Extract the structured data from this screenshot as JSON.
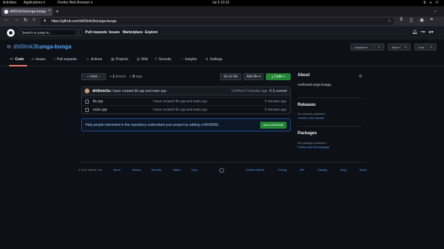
{
  "desktop": {
    "activities": "Activities",
    "applications": "Applications ▾",
    "app_name": "Firefox Web Browser ▾",
    "clock": "Jul 6  10:10",
    "tray_icons": [
      "network-icon",
      "volume-icon",
      "power-icon"
    ]
  },
  "browser": {
    "tab_title": "dh00mk3tu/unga-bunga",
    "new_tab": "+",
    "url": "https://github.com/dh00mk3tu/unga-bunga"
  },
  "github_header": {
    "search_placeholder": "Search or jump to...",
    "search_key": "/",
    "nav": [
      "Pull requests",
      "Issues",
      "Marketplace",
      "Explore"
    ]
  },
  "repo": {
    "owner": "dh00mk3tu",
    "separator": "/",
    "name": "unga-bunga",
    "unwatch": "Unwatch ▾",
    "unwatch_count": "1",
    "star": "Star ▾",
    "star_count": "0",
    "fork": "Fork",
    "fork_count": "0"
  },
  "tabs": [
    "Code",
    "Issues",
    "Pull requests",
    "Actions",
    "Projects",
    "Wiki",
    "Security",
    "Insights",
    "Settings"
  ],
  "toolbar": {
    "branch": "main ▾",
    "branches_count": "1",
    "branches_label": "branch",
    "tags_count": "0",
    "tags_label": "tags",
    "go_to_file": "Go to file",
    "add_file": "Add file ▾",
    "code": "Code ▾"
  },
  "latest_commit": {
    "author": "dh00mk3tu",
    "message": "i have created lib.cpp and main.cpp",
    "sha": "7c244e4",
    "age": "5 minutes ago",
    "count": "1",
    "count_label": "commit"
  },
  "files": [
    {
      "name": "lib.cpp",
      "message": "i have created lib.cpp and main.cpp",
      "age": "5 minutes ago"
    },
    {
      "name": "main.cpp",
      "message": "i have created lib.cpp and main.cpp",
      "age": "5 minutes ago"
    }
  ],
  "readme_banner": {
    "text": "Help people interested in this repository understand your project by adding a README.",
    "button": "Add a README"
  },
  "sidebar": {
    "about_title": "About",
    "about_desc": "confused unga bunga",
    "releases_title": "Releases",
    "releases_none": "No releases published",
    "releases_link": "Create a new release",
    "packages_title": "Packages",
    "packages_none": "No packages published",
    "packages_link": "Publish your first package"
  },
  "footer": {
    "copyright": "© 2021 GitHub, Inc.",
    "links": [
      "Terms",
      "Privacy",
      "Security",
      "Status",
      "Docs",
      "Contact GitHub",
      "Pricing",
      "API",
      "Training",
      "Blog",
      "About"
    ]
  },
  "colors": {
    "page_bg": "#0d1117",
    "header_bg": "#161b22",
    "link": "#58a6ff",
    "primary_button": "#238636",
    "selected_tab": "#f78166"
  }
}
